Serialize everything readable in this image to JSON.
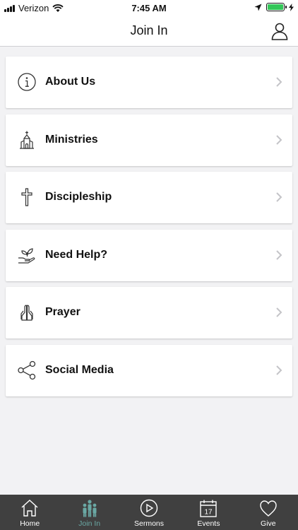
{
  "status_bar": {
    "carrier": "Verizon",
    "time": "7:45 AM",
    "battery_color": "#34c759"
  },
  "nav": {
    "title": "Join In"
  },
  "menu": {
    "items": [
      {
        "label": "About Us",
        "icon": "info-circle-icon"
      },
      {
        "label": "Ministries",
        "icon": "church-icon"
      },
      {
        "label": "Discipleship",
        "icon": "cross-icon"
      },
      {
        "label": "Need Help?",
        "icon": "hand-plant-icon"
      },
      {
        "label": "Prayer",
        "icon": "praying-hands-icon"
      },
      {
        "label": "Social Media",
        "icon": "share-icon"
      }
    ]
  },
  "tab_bar": {
    "background": "#404040",
    "active_color": "#6aa8a4",
    "tabs": [
      {
        "label": "Home",
        "icon": "home-icon"
      },
      {
        "label": "Join In",
        "icon": "people-icon"
      },
      {
        "label": "Sermons",
        "icon": "play-circle-icon"
      },
      {
        "label": "Events",
        "icon": "calendar-icon",
        "calendar_day": "17"
      },
      {
        "label": "Give",
        "icon": "heart-icon"
      }
    ]
  }
}
